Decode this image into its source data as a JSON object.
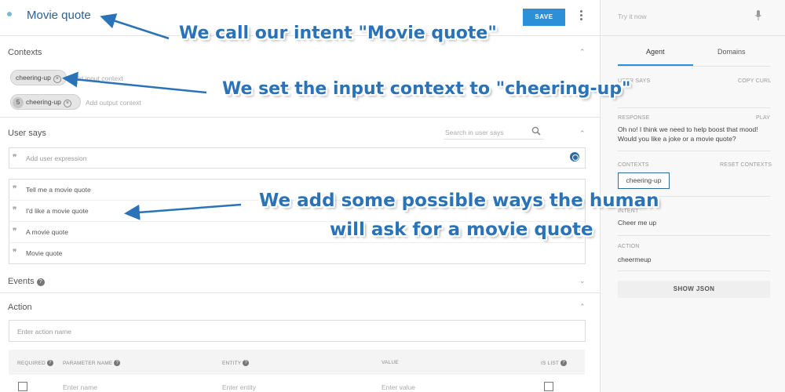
{
  "header": {
    "title": "Movie quote",
    "save_label": "SAVE"
  },
  "contexts": {
    "title": "Contexts",
    "input_context": "cheering-up",
    "input_placeholder": "Add input context",
    "output_count": "5",
    "output_context": "cheering-up",
    "output_placeholder": "Add output context"
  },
  "user_says": {
    "title": "User says",
    "search_placeholder": "Search in user says",
    "add_placeholder": "Add user expression",
    "expressions": [
      "Tell me a movie quote",
      "I'd like a movie quote",
      "A movie quote",
      "Movie quote"
    ]
  },
  "events": {
    "title": "Events"
  },
  "action": {
    "title": "Action",
    "name_placeholder": "Enter action name",
    "columns": [
      "REQUIRED",
      "PARAMETER NAME",
      "ENTITY",
      "VALUE",
      "IS LIST"
    ],
    "row_placeholders": {
      "name": "Enter name",
      "entity": "Enter entity",
      "value": "Enter value"
    }
  },
  "side": {
    "try_placeholder": "Try it now",
    "tabs": [
      "Agent",
      "Domains"
    ],
    "user_says_label": "USER SAYS",
    "copy_curl": "COPY CURL",
    "response_label": "RESPONSE",
    "play": "PLAY",
    "response_text": "Oh no! I think we need to help boost that mood! Would you like a joke or a movie quote?",
    "contexts_label": "CONTEXTS",
    "reset_contexts": "RESET CONTEXTS",
    "context_value": "cheering-up",
    "intent_label": "INTENT",
    "intent_value": "Cheer me up",
    "action_label": "ACTION",
    "action_value": "cheermeup",
    "show_json": "SHOW JSON"
  },
  "annotations": {
    "a1": "We call our intent \"Movie quote\"",
    "a2": "We set the input context to \"cheering-up\"",
    "a3_line1": "We add some possible ways the human",
    "a3_line2": "will ask for a movie quote"
  },
  "colors": {
    "accent": "#2d8fd5",
    "annotation": "#2a73b8",
    "title": "#2f5e8e"
  }
}
